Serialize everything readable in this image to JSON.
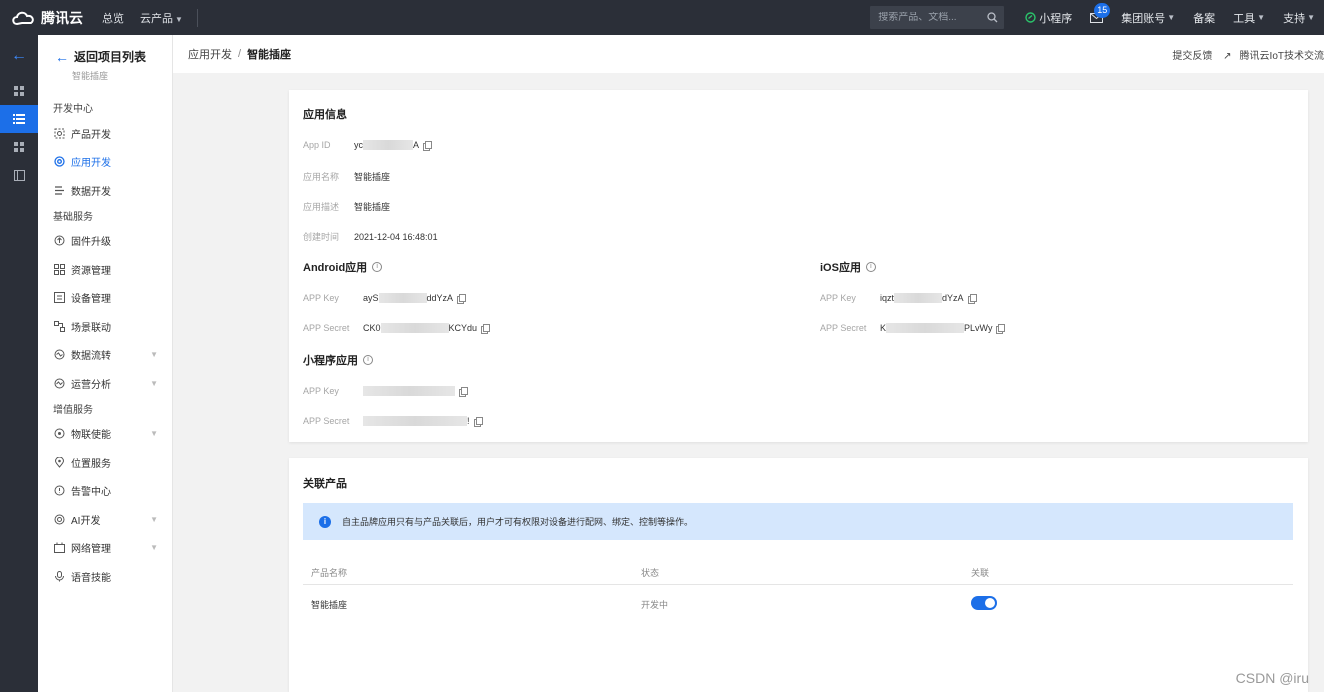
{
  "topbar": {
    "brand": "腾讯云",
    "nav": [
      "总览",
      "云产品"
    ],
    "search_placeholder": "搜索产品、文档...",
    "mini_program": "小程序",
    "mail_badge": "15",
    "account": "集团账号",
    "record": "备案",
    "tools": "工具",
    "support": "支持"
  },
  "sidemenu": {
    "back_label": "返回项目列表",
    "back_sub": "智能插座",
    "groups": [
      {
        "title": "开发中心",
        "items": [
          "产品开发",
          "应用开发",
          "数据开发"
        ]
      },
      {
        "title": "基础服务",
        "items": [
          "固件升级",
          "资源管理",
          "设备管理",
          "场景联动",
          "数据流转",
          "运营分析"
        ]
      },
      {
        "title": "增值服务",
        "items": [
          "物联使能",
          "位置服务",
          "告警中心",
          "AI开发",
          "网络管理",
          "语音技能"
        ]
      }
    ]
  },
  "breadcrumb": {
    "parent": "应用开发",
    "sep": "/",
    "current": "智能插座",
    "feedback": "提交反馈",
    "community": "腾讯云IoT技术交流"
  },
  "app_info": {
    "title": "应用信息",
    "fields": [
      {
        "label": "App ID",
        "prefix": "yc",
        "suffix": "A"
      },
      {
        "label": "应用名称",
        "value": "智能插座"
      },
      {
        "label": "应用描述",
        "value": "智能插座"
      },
      {
        "label": "创建时间",
        "value": "2021-12-04 16:48:01"
      }
    ],
    "android": {
      "title": "Android应用",
      "key_label": "APP Key",
      "key_prefix": "ayS",
      "key_suffix": "ddYzA",
      "secret_label": "APP Secret",
      "secret_prefix": "CK0",
      "secret_suffix": "KCYdu"
    },
    "ios": {
      "title": "iOS应用",
      "key_label": "APP Key",
      "key_prefix": "iqzt",
      "key_suffix": "dYzA",
      "secret_label": "APP Secret",
      "secret_prefix": "K",
      "secret_suffix": "PLvWy"
    },
    "mini": {
      "title": "小程序应用",
      "key_label": "APP Key",
      "secret_label": "APP Secret",
      "secret_suffix": "!"
    }
  },
  "related": {
    "title": "关联产品",
    "notice": "自主品牌应用只有与产品关联后，用户才可有权限对设备进行配网、绑定、控制等操作。",
    "columns": [
      "产品名称",
      "状态",
      "关联"
    ],
    "rows": [
      {
        "name": "智能插座",
        "status": "开发中",
        "linked": true
      }
    ]
  },
  "watermark": "CSDN @iru",
  "colors": {
    "accent": "#1c6fe8",
    "topbar": "#2b2f38",
    "notice_bg": "#d5e7fd"
  }
}
